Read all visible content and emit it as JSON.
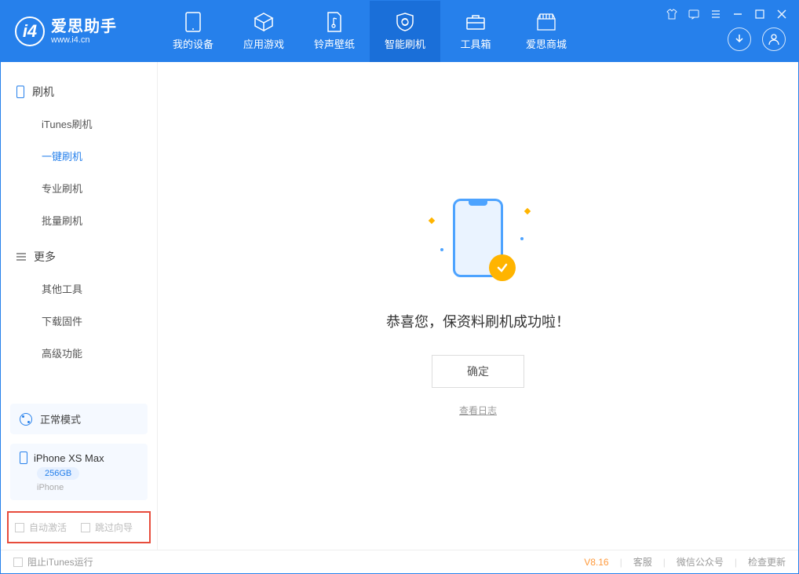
{
  "app": {
    "title": "爱思助手",
    "subtitle": "www.i4.cn"
  },
  "nav": {
    "tabs": [
      {
        "label": "我的设备"
      },
      {
        "label": "应用游戏"
      },
      {
        "label": "铃声壁纸"
      },
      {
        "label": "智能刷机"
      },
      {
        "label": "工具箱"
      },
      {
        "label": "爱思商城"
      }
    ]
  },
  "sidebar": {
    "section1": {
      "heading": "刷机",
      "items": [
        {
          "label": "iTunes刷机"
        },
        {
          "label": "一键刷机"
        },
        {
          "label": "专业刷机"
        },
        {
          "label": "批量刷机"
        }
      ]
    },
    "section2": {
      "heading": "更多",
      "items": [
        {
          "label": "其他工具"
        },
        {
          "label": "下载固件"
        },
        {
          "label": "高级功能"
        }
      ]
    },
    "mode_label": "正常模式",
    "device": {
      "name": "iPhone XS Max",
      "capacity": "256GB",
      "type": "iPhone"
    },
    "options": {
      "auto_activate": "自动激活",
      "skip_guide": "跳过向导"
    }
  },
  "main": {
    "success_text": "恭喜您，保资料刷机成功啦！",
    "ok_label": "确定",
    "log_link": "查看日志"
  },
  "footer": {
    "block_itunes": "阻止iTunes运行",
    "version": "V8.16",
    "support": "客服",
    "wechat": "微信公众号",
    "update": "检查更新"
  }
}
